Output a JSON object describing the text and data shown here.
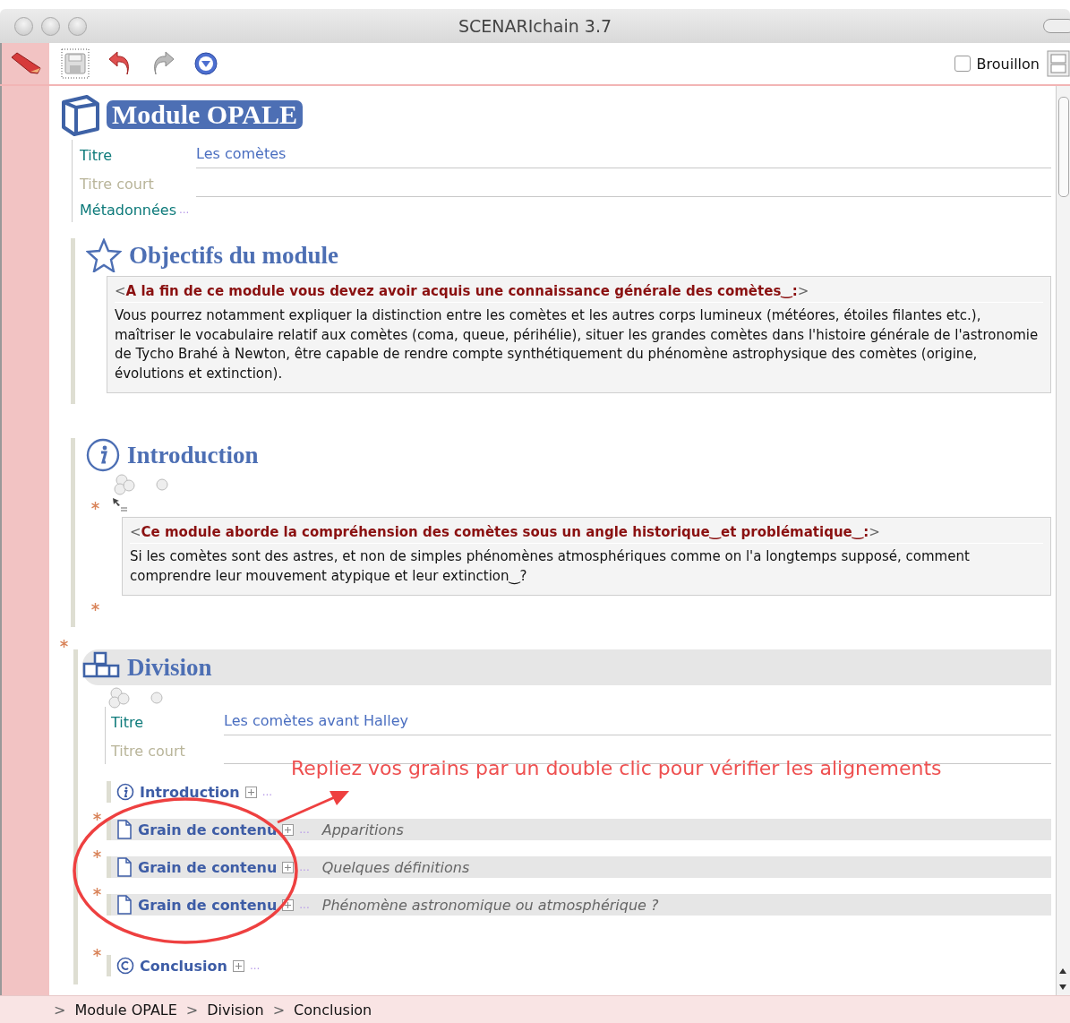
{
  "window": {
    "title": "SCENARIchain 3.7"
  },
  "toolbar": {
    "draft": {
      "label": "Brouillon",
      "checked": false
    }
  },
  "module": {
    "title": "Module OPALE",
    "fields": [
      {
        "label": "Titre",
        "value": "Les comètes",
        "empty": false
      },
      {
        "label": "Titre court",
        "empty": true
      }
    ],
    "metadata": {
      "label": "Métadonnées",
      "more": "..."
    }
  },
  "objectives": {
    "title": "Objectifs du module",
    "open": "<",
    "heading": "A la fin de ce module vous devez avoir acquis une connaissance générale des comètes‿:",
    "close": ">",
    "body": "Vous pourrez notamment expliquer la distinction entre les comètes et les autres corps lumineux (météores, étoiles filantes etc.), maîtriser le vocabulaire relatif aux comètes (coma, queue, périhélie), situer les grandes comètes dans l'histoire générale de l'astronomie de Tycho Brahé à Newton, être capable de rendre compte synthétiquement du phénomène astrophysique des comètes (origine, évolutions et extinction)."
  },
  "introduction": {
    "title": "Introduction",
    "open": "<",
    "heading": "Ce module aborde la compréhension des comètes sous un angle historique‿et problématique‿:",
    "close": ">",
    "body": "Si les comètes sont des astres, et non de simples phénomènes atmosphériques comme on l'a longtemps supposé, comment comprendre leur mouvement atypique et leur extinction‿?"
  },
  "division": {
    "title": "Division",
    "fields": [
      {
        "label": "Titre",
        "value": "Les comètes avant Halley",
        "empty": false
      },
      {
        "label": "Titre court",
        "empty": true
      }
    ],
    "items": [
      {
        "kind": "intro",
        "label": "Introduction",
        "more": "...",
        "marked": false
      },
      {
        "kind": "grain",
        "label": "Grain de contenu",
        "more": "...",
        "subtitle": "Apparitions",
        "marked": true
      },
      {
        "kind": "grain",
        "label": "Grain de contenu",
        "more": "...",
        "subtitle": "Quelques définitions",
        "marked": true
      },
      {
        "kind": "grain",
        "label": "Grain de contenu",
        "more": "...",
        "subtitle": "Phénomène astronomique ou atmosphérique ?",
        "marked": true
      },
      {
        "kind": "conclusion",
        "label": "Conclusion",
        "more": "...",
        "marked": true
      }
    ]
  },
  "annotation": {
    "text": "Repliez vos grains par un double clic pour vérifier les alignements"
  },
  "breadcrumb": {
    "separator": ">",
    "items": [
      "Module OPALE",
      "Division",
      "Conclusion"
    ]
  }
}
